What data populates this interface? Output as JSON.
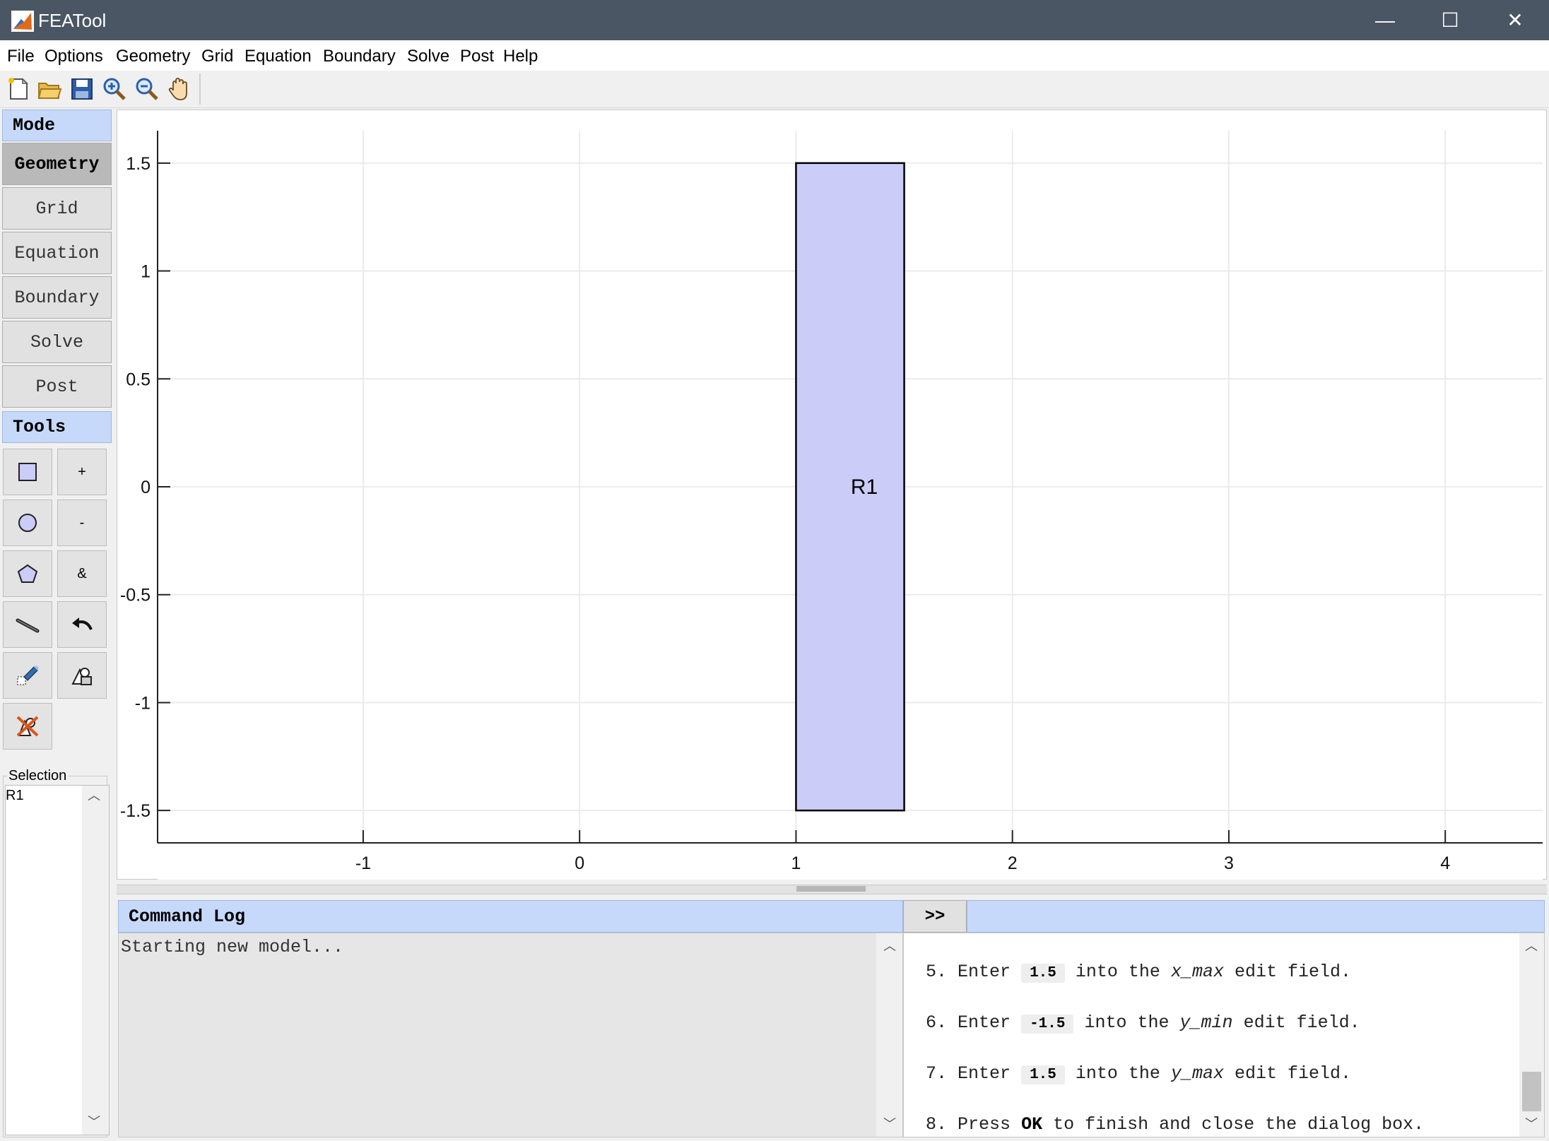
{
  "window": {
    "title": "FEATool",
    "minimize": "—",
    "maximize": "☐",
    "close": "✕"
  },
  "menu": [
    "File",
    "Options",
    "Geometry",
    "Grid",
    "Equation",
    "Boundary",
    "Solve",
    "Post",
    "Help"
  ],
  "toolbar": [
    "new-file-icon",
    "open-folder-icon",
    "save-icon",
    "zoom-in-icon",
    "zoom-out-icon",
    "pan-hand-icon"
  ],
  "mode": {
    "header": "Mode",
    "buttons": [
      "Geometry",
      "Grid",
      "Equation",
      "Boundary",
      "Solve",
      "Post"
    ],
    "active": "Geometry"
  },
  "tools": {
    "header": "Tools",
    "buttons": [
      "rectangle-icon",
      "+",
      "circle-icon",
      "-",
      "polygon-icon",
      "&",
      "line-icon",
      "undo-icon",
      "edit-object-icon",
      "object-properties-icon",
      "delete-all-icon"
    ]
  },
  "selection": {
    "label": "Selection",
    "items": [
      "R1"
    ]
  },
  "plot": {
    "x_ticks": [
      "-1",
      "0",
      "1",
      "2",
      "3",
      "4"
    ],
    "y_ticks": [
      "1.5",
      "1",
      "0.5",
      "0",
      "-0.5",
      "-1",
      "-1.5"
    ],
    "xlim": [
      -1.95,
      4.45
    ],
    "ylim": [
      -1.65,
      1.65
    ],
    "grid": true,
    "objects": [
      {
        "label": "R1",
        "type": "rectangle",
        "x_min": 1,
        "x_max": 1.5,
        "y_min": -1.5,
        "y_max": 1.5,
        "fill": "#ccccf9",
        "stroke": "#000000"
      }
    ]
  },
  "command_log": {
    "header": "Command Log",
    "toggle": ">>",
    "text": "Starting new model..."
  },
  "help_steps": [
    {
      "num": "5.",
      "pre": "Enter",
      "value": "1.5",
      "mid": "into the",
      "field": "x_max",
      "post": "edit field."
    },
    {
      "num": "6.",
      "pre": "Enter",
      "value": "-1.5",
      "mid": "into the",
      "field": "y_min",
      "post": "edit field."
    },
    {
      "num": "7.",
      "pre": "Enter",
      "value": "1.5",
      "mid": "into the",
      "field": "y_max",
      "post": "edit field."
    },
    {
      "num": "8.",
      "pre": "Press",
      "bold": "OK",
      "post": "to finish and close the dialog box."
    }
  ]
}
